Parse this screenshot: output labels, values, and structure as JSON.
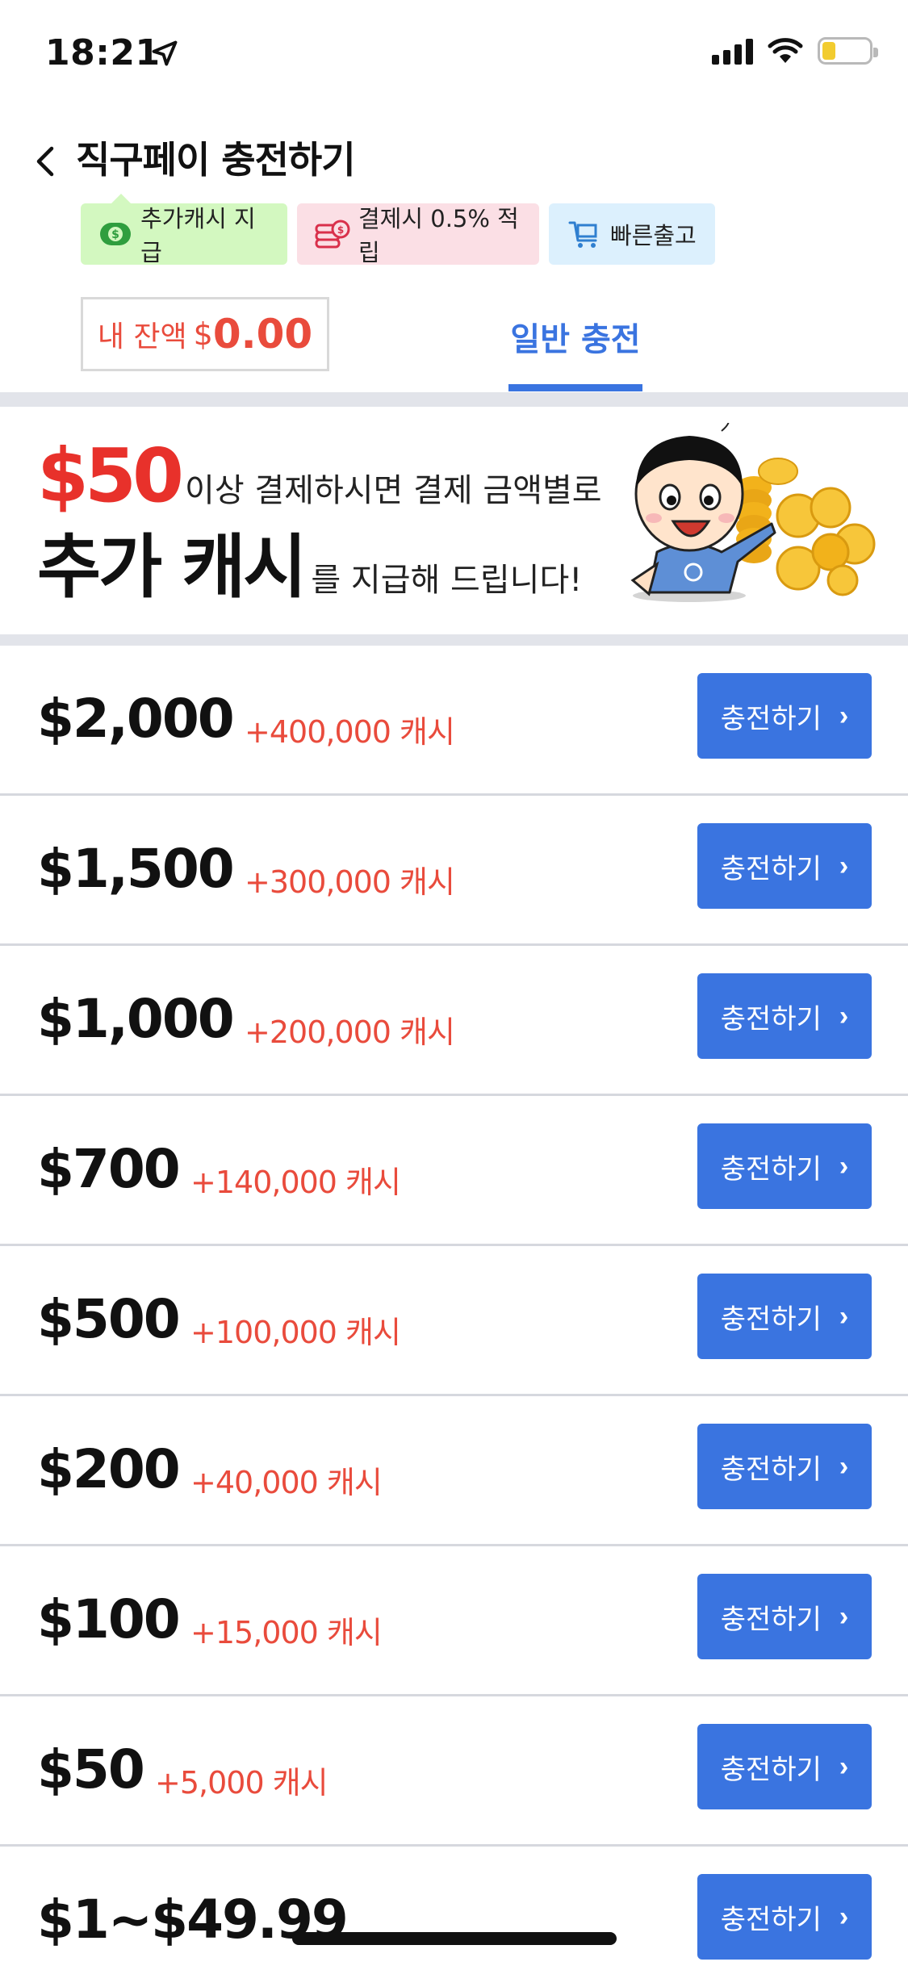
{
  "status_bar": {
    "time": "18:21"
  },
  "header": {
    "title": "직구페이 충전하기"
  },
  "badges": [
    {
      "label": "추가캐시 지급"
    },
    {
      "label": "결제시 0.5% 적립"
    },
    {
      "label": "빠른출고"
    }
  ],
  "balance": {
    "label": "내 잔액",
    "currency": "$",
    "value": "0.00"
  },
  "tabs": {
    "general": "일반 충전"
  },
  "promo": {
    "amount": "$50",
    "line1": "이상 결제하시면 결제 금액별로",
    "highlight": "추가 캐시",
    "line2": "를 지급해 드립니다!"
  },
  "charge_options": [
    {
      "amount": "$2,000",
      "bonus": "+400,000 캐시"
    },
    {
      "amount": "$1,500",
      "bonus": "+300,000 캐시"
    },
    {
      "amount": "$1,000",
      "bonus": "+200,000 캐시"
    },
    {
      "amount": "$700",
      "bonus": "+140,000 캐시"
    },
    {
      "amount": "$500",
      "bonus": "+100,000 캐시"
    },
    {
      "amount": "$200",
      "bonus": "+40,000 캐시"
    },
    {
      "amount": "$100",
      "bonus": "+15,000 캐시"
    },
    {
      "amount": "$50",
      "bonus": "+5,000 캐시"
    },
    {
      "amount": "$1~$49.99",
      "bonus": ""
    }
  ],
  "charge_button_label": "충전하기",
  "colors": {
    "accent": "#3a74e0",
    "bonus": "#e94b3c",
    "promo_red": "#e8312b"
  }
}
